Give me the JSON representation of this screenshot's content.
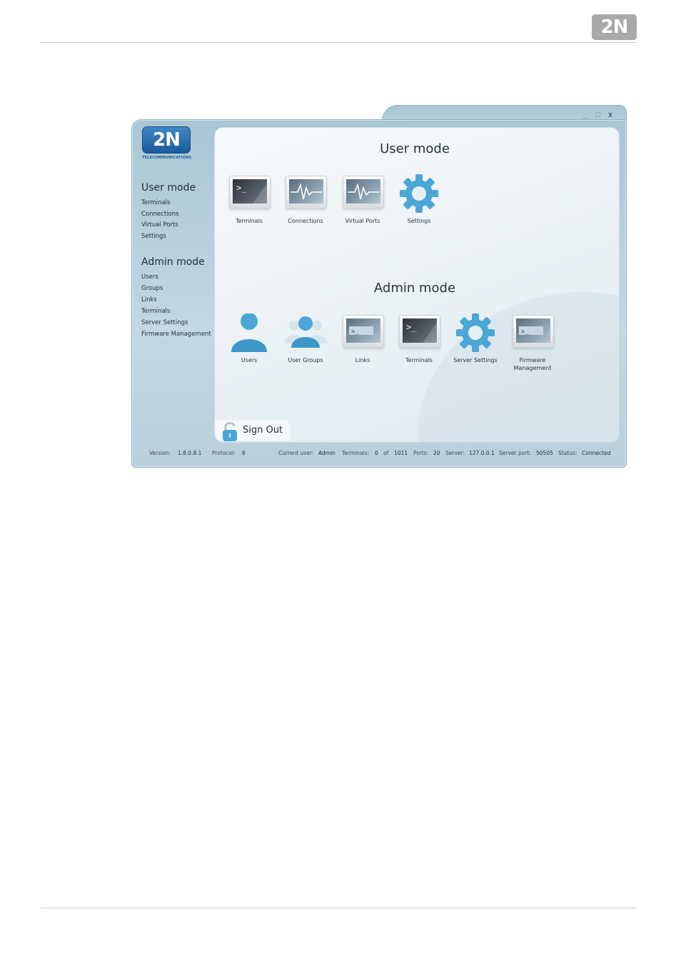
{
  "page": {
    "brand_logo_text": "2N"
  },
  "window": {
    "controls": {
      "minimize": "_",
      "maximize": "□",
      "close": "x"
    },
    "brand": {
      "logo_text": "2N",
      "subtitle": "TELECOMMUNICATIONS"
    }
  },
  "sidebar": {
    "user_mode": {
      "heading": "User mode",
      "items": [
        "Terminals",
        "Connections",
        "Virtual Ports",
        "Settings"
      ]
    },
    "admin_mode": {
      "heading": "Admin mode",
      "items": [
        "Users",
        "Groups",
        "Links",
        "Terminals",
        "Server Settings",
        "Firmware Management"
      ]
    }
  },
  "main": {
    "user_mode": {
      "title": "User mode",
      "tiles": [
        {
          "label": "Terminals",
          "icon": "terminal-icon"
        },
        {
          "label": "Connections",
          "icon": "connections-icon"
        },
        {
          "label": "Virtual Ports",
          "icon": "virtual-ports-icon"
        },
        {
          "label": "Settings",
          "icon": "gear-icon"
        }
      ]
    },
    "admin_mode": {
      "title": "Admin mode",
      "tiles": [
        {
          "label": "Users",
          "icon": "user-icon"
        },
        {
          "label": "User Groups",
          "icon": "user-groups-icon"
        },
        {
          "label": "Links",
          "icon": "links-icon"
        },
        {
          "label": "Terminals",
          "icon": "terminal-icon"
        },
        {
          "label": "Server Settings",
          "icon": "gear-icon"
        },
        {
          "label": "Firmware",
          "label_line2": "Management",
          "icon": "firmware-icon"
        }
      ]
    },
    "sign_out_label": "Sign Out"
  },
  "status": {
    "version_label": "Version:",
    "version": "1.8.0.8.1",
    "protocol_label": "Protocol:",
    "protocol": "6",
    "user_label": "Current user:",
    "user": "Admin",
    "terminals_label": "Terminals:",
    "terminals_active": "0",
    "of_label": "of",
    "terminals_total": "1011",
    "ports_label": "Ports:",
    "ports": "20",
    "server_label": "Server:",
    "server": "127.0.0.1",
    "server_port_label": "Server port:",
    "server_port": "50505",
    "status_label": "Status:",
    "status": "Connected"
  },
  "colors": {
    "accent": "#3f9fca",
    "window_frame": "#a9c6d4",
    "text": "#1e2d36"
  }
}
